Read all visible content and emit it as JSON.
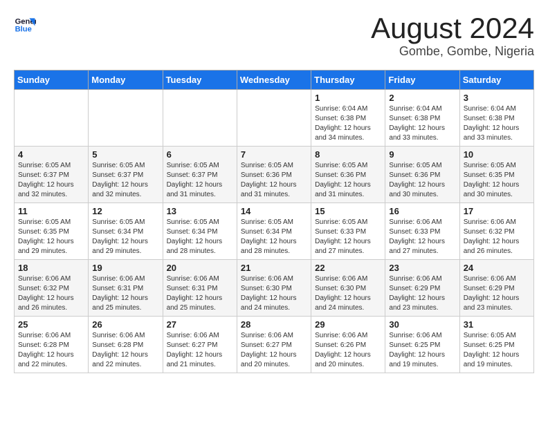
{
  "header": {
    "logo_line1": "General",
    "logo_line2": "Blue",
    "title": "August 2024",
    "subtitle": "Gombe, Gombe, Nigeria"
  },
  "weekdays": [
    "Sunday",
    "Monday",
    "Tuesday",
    "Wednesday",
    "Thursday",
    "Friday",
    "Saturday"
  ],
  "weeks": [
    [
      {
        "day": "",
        "info": ""
      },
      {
        "day": "",
        "info": ""
      },
      {
        "day": "",
        "info": ""
      },
      {
        "day": "",
        "info": ""
      },
      {
        "day": "1",
        "info": "Sunrise: 6:04 AM\nSunset: 6:38 PM\nDaylight: 12 hours\nand 34 minutes."
      },
      {
        "day": "2",
        "info": "Sunrise: 6:04 AM\nSunset: 6:38 PM\nDaylight: 12 hours\nand 33 minutes."
      },
      {
        "day": "3",
        "info": "Sunrise: 6:04 AM\nSunset: 6:38 PM\nDaylight: 12 hours\nand 33 minutes."
      }
    ],
    [
      {
        "day": "4",
        "info": "Sunrise: 6:05 AM\nSunset: 6:37 PM\nDaylight: 12 hours\nand 32 minutes."
      },
      {
        "day": "5",
        "info": "Sunrise: 6:05 AM\nSunset: 6:37 PM\nDaylight: 12 hours\nand 32 minutes."
      },
      {
        "day": "6",
        "info": "Sunrise: 6:05 AM\nSunset: 6:37 PM\nDaylight: 12 hours\nand 31 minutes."
      },
      {
        "day": "7",
        "info": "Sunrise: 6:05 AM\nSunset: 6:36 PM\nDaylight: 12 hours\nand 31 minutes."
      },
      {
        "day": "8",
        "info": "Sunrise: 6:05 AM\nSunset: 6:36 PM\nDaylight: 12 hours\nand 31 minutes."
      },
      {
        "day": "9",
        "info": "Sunrise: 6:05 AM\nSunset: 6:36 PM\nDaylight: 12 hours\nand 30 minutes."
      },
      {
        "day": "10",
        "info": "Sunrise: 6:05 AM\nSunset: 6:35 PM\nDaylight: 12 hours\nand 30 minutes."
      }
    ],
    [
      {
        "day": "11",
        "info": "Sunrise: 6:05 AM\nSunset: 6:35 PM\nDaylight: 12 hours\nand 29 minutes."
      },
      {
        "day": "12",
        "info": "Sunrise: 6:05 AM\nSunset: 6:34 PM\nDaylight: 12 hours\nand 29 minutes."
      },
      {
        "day": "13",
        "info": "Sunrise: 6:05 AM\nSunset: 6:34 PM\nDaylight: 12 hours\nand 28 minutes."
      },
      {
        "day": "14",
        "info": "Sunrise: 6:05 AM\nSunset: 6:34 PM\nDaylight: 12 hours\nand 28 minutes."
      },
      {
        "day": "15",
        "info": "Sunrise: 6:05 AM\nSunset: 6:33 PM\nDaylight: 12 hours\nand 27 minutes."
      },
      {
        "day": "16",
        "info": "Sunrise: 6:06 AM\nSunset: 6:33 PM\nDaylight: 12 hours\nand 27 minutes."
      },
      {
        "day": "17",
        "info": "Sunrise: 6:06 AM\nSunset: 6:32 PM\nDaylight: 12 hours\nand 26 minutes."
      }
    ],
    [
      {
        "day": "18",
        "info": "Sunrise: 6:06 AM\nSunset: 6:32 PM\nDaylight: 12 hours\nand 26 minutes."
      },
      {
        "day": "19",
        "info": "Sunrise: 6:06 AM\nSunset: 6:31 PM\nDaylight: 12 hours\nand 25 minutes."
      },
      {
        "day": "20",
        "info": "Sunrise: 6:06 AM\nSunset: 6:31 PM\nDaylight: 12 hours\nand 25 minutes."
      },
      {
        "day": "21",
        "info": "Sunrise: 6:06 AM\nSunset: 6:30 PM\nDaylight: 12 hours\nand 24 minutes."
      },
      {
        "day": "22",
        "info": "Sunrise: 6:06 AM\nSunset: 6:30 PM\nDaylight: 12 hours\nand 24 minutes."
      },
      {
        "day": "23",
        "info": "Sunrise: 6:06 AM\nSunset: 6:29 PM\nDaylight: 12 hours\nand 23 minutes."
      },
      {
        "day": "24",
        "info": "Sunrise: 6:06 AM\nSunset: 6:29 PM\nDaylight: 12 hours\nand 23 minutes."
      }
    ],
    [
      {
        "day": "25",
        "info": "Sunrise: 6:06 AM\nSunset: 6:28 PM\nDaylight: 12 hours\nand 22 minutes."
      },
      {
        "day": "26",
        "info": "Sunrise: 6:06 AM\nSunset: 6:28 PM\nDaylight: 12 hours\nand 22 minutes."
      },
      {
        "day": "27",
        "info": "Sunrise: 6:06 AM\nSunset: 6:27 PM\nDaylight: 12 hours\nand 21 minutes."
      },
      {
        "day": "28",
        "info": "Sunrise: 6:06 AM\nSunset: 6:27 PM\nDaylight: 12 hours\nand 20 minutes."
      },
      {
        "day": "29",
        "info": "Sunrise: 6:06 AM\nSunset: 6:26 PM\nDaylight: 12 hours\nand 20 minutes."
      },
      {
        "day": "30",
        "info": "Sunrise: 6:06 AM\nSunset: 6:25 PM\nDaylight: 12 hours\nand 19 minutes."
      },
      {
        "day": "31",
        "info": "Sunrise: 6:05 AM\nSunset: 6:25 PM\nDaylight: 12 hours\nand 19 minutes."
      }
    ]
  ]
}
